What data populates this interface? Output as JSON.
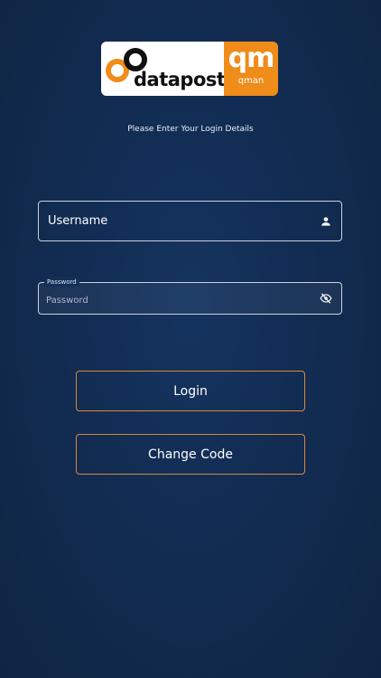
{
  "logo": {
    "brand_text": "datapost",
    "badge_text": "qm",
    "badge_subtext": "qman",
    "colors": {
      "brand_orange": "#f08c1a",
      "brand_dark": "#111111"
    }
  },
  "subtitle": "Please Enter Your Login Details",
  "form": {
    "username": {
      "placeholder": "Username",
      "value": "",
      "icon": "person-icon"
    },
    "password": {
      "label": "Password",
      "placeholder": "Password",
      "value": "",
      "icon": "eye-off-icon"
    }
  },
  "buttons": {
    "login": "Login",
    "change_code": "Change Code"
  },
  "colors": {
    "background": "#122c52",
    "button_border": "#d9893a",
    "field_border": "#c9d3e2"
  }
}
